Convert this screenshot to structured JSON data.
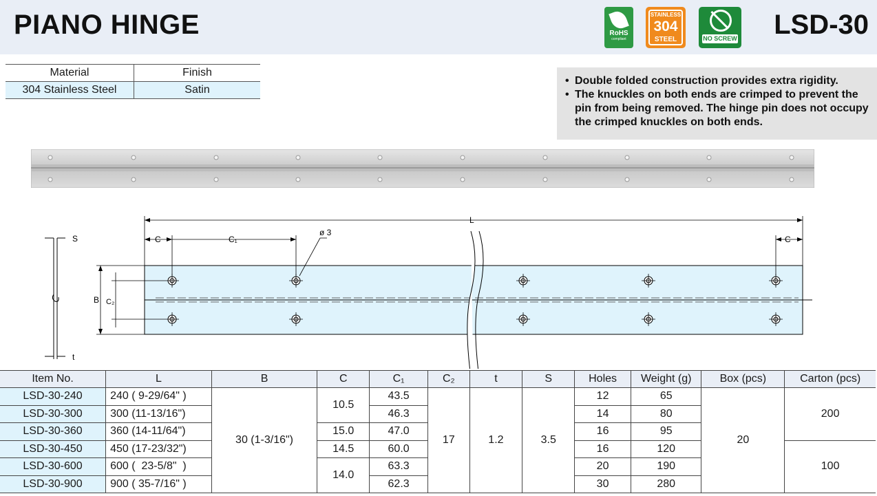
{
  "header": {
    "title": "PIANO HINGE",
    "model": "LSD-30",
    "badges": {
      "rohs": {
        "line1": "RoHS",
        "line2": "compliant"
      },
      "stainless": {
        "top": "STAINLESS",
        "mid": "304",
        "bottom": "STEEL"
      },
      "no_screw": {
        "label": "NO SCREW"
      }
    },
    "colors": {
      "rohs": "#2e9a44",
      "stainless": "#f08a1d",
      "no_screw": "#1e8a3a"
    }
  },
  "material_table": {
    "headers": [
      "Material",
      "Finish"
    ],
    "values": [
      "304 Stainless Steel",
      "Satin"
    ]
  },
  "features": [
    "Double folded construction provides extra rigidity.",
    "The knuckles on both ends are crimped to prevent the pin from being removed. The hinge pin does not occupy the crimped knuckles on both ends."
  ],
  "drawing_labels": {
    "S": "S",
    "t": "t",
    "B": "B",
    "C2": "C₂",
    "C": "C",
    "C1": "C₁",
    "L": "L",
    "hole": "ø 3"
  },
  "spec_table": {
    "headers": [
      "Item No.",
      "L",
      "B",
      "C",
      "C₁",
      "C₂",
      "t",
      "S",
      "Holes",
      "Weight (g)",
      "Box (pcs)",
      "Carton (pcs)"
    ],
    "items": [
      "LSD-30-240",
      "LSD-30-300",
      "LSD-30-360",
      "LSD-30-450",
      "LSD-30-600",
      "LSD-30-900"
    ],
    "lengths": [
      "240 ( 9-29/64\" )",
      "300 (11-13/16\")",
      "360 (14-11/64\")",
      "450 (17-23/32\")",
      "600 (  23-5/8\"  )",
      "900 ( 35-7/16\" )"
    ],
    "B": "30 (1-3/16\")",
    "C": [
      "10.5",
      "15.0",
      "14.5",
      "14.0"
    ],
    "C1": [
      "43.5",
      "46.3",
      "47.0",
      "60.0",
      "63.3",
      "62.3"
    ],
    "C2": "17",
    "t": "1.2",
    "S": "3.5",
    "holes": [
      "12",
      "14",
      "16",
      "16",
      "20",
      "30"
    ],
    "weight": [
      "65",
      "80",
      "95",
      "120",
      "190",
      "280"
    ],
    "box": "20",
    "carton": [
      "200",
      "100"
    ]
  }
}
